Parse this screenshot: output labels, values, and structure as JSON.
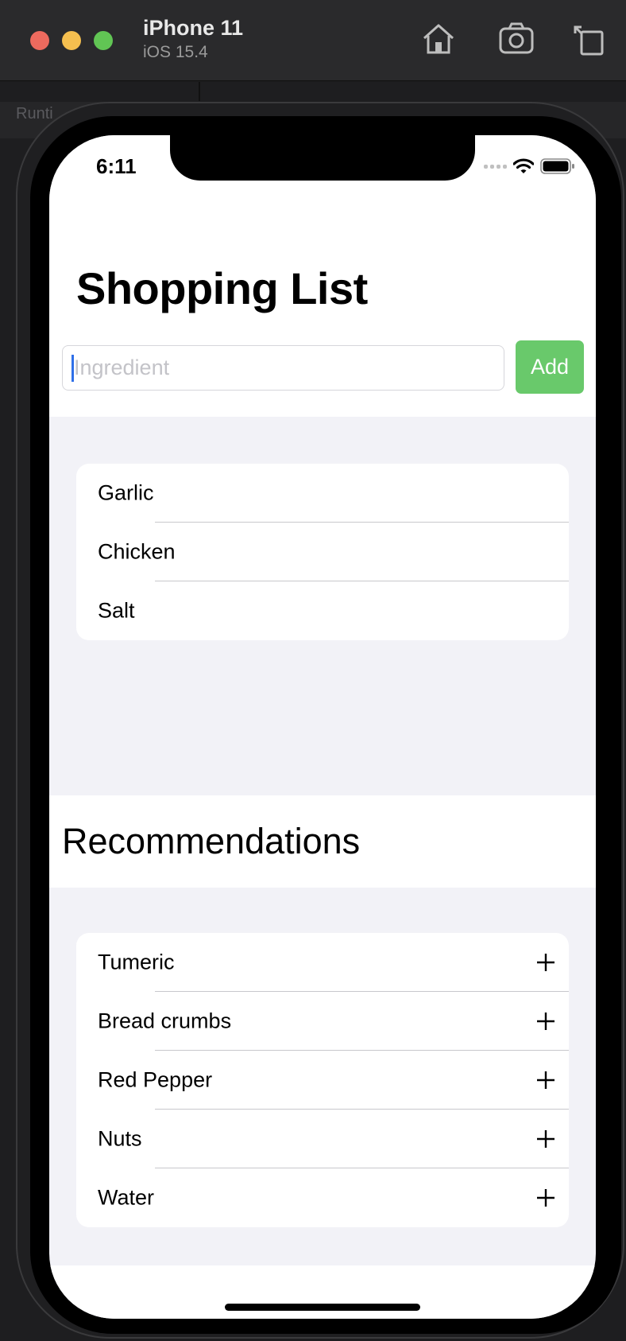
{
  "window": {
    "device_name": "iPhone 11",
    "os_version": "iOS 15.4",
    "background_tab": "Runti",
    "icons": [
      "home-icon",
      "camera-icon",
      "rotate-icon"
    ]
  },
  "status_bar": {
    "time": "6:11",
    "icons": [
      "cellular-icon",
      "wifi-icon",
      "battery-icon"
    ]
  },
  "screen": {
    "title": "Shopping List",
    "ingredient_input": {
      "value": "",
      "placeholder": "Ingredient"
    },
    "add_button": "Add",
    "shopping_items": [
      "Garlic",
      "Chicken",
      "Salt"
    ],
    "recommendations_title": "Recommendations",
    "recommendations": [
      "Tumeric",
      "Bread crumbs",
      "Red Pepper",
      "Nuts",
      "Water"
    ]
  },
  "colors": {
    "add_button": "#69c96b",
    "grouped_background": "#f2f2f7",
    "caret": "#2f6fe8"
  }
}
